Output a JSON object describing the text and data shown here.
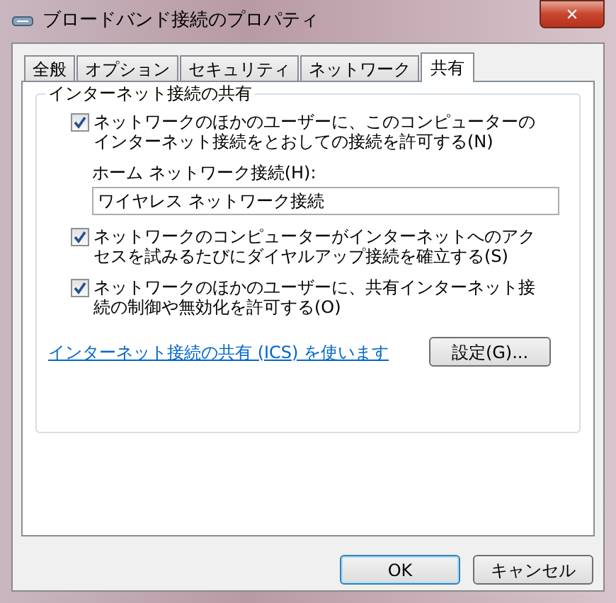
{
  "window": {
    "title": "ブロードバンド接続のプロパティ",
    "close": "✕"
  },
  "tabs": [
    {
      "label": "全般",
      "selected": false
    },
    {
      "label": "オプション",
      "selected": false
    },
    {
      "label": "セキュリティ",
      "selected": false
    },
    {
      "label": "ネットワーク",
      "selected": false
    },
    {
      "label": "共有",
      "selected": true
    }
  ],
  "group": {
    "title": "インターネット接続の共有",
    "options": [
      {
        "kind": "checkbox",
        "label": "ネットワークのほかのユーザーに、このコンピューターのインターネット接続をとおしての接続を許可する(N)",
        "checked": true
      },
      {
        "kind": "field",
        "label": "ホーム ネットワーク接続(H):",
        "value": "ワイヤレス ネットワーク接続"
      },
      {
        "kind": "checkbox",
        "label": "ネットワークのコンピューターがインターネットへのアクセスを試みるたびにダイヤルアップ接続を確立する(S)",
        "checked": true
      },
      {
        "kind": "checkbox",
        "label": "ネットワークのほかのユーザーに、共有インターネット接続の制御や無効化を許可する(O)",
        "checked": true
      }
    ]
  },
  "link": "インターネット接続の共有 (ICS) を使います",
  "settings_button": "設定(G)...",
  "buttons": [
    {
      "label": "OK",
      "default": true
    },
    {
      "label": "キャンセル",
      "default": false
    }
  ]
}
